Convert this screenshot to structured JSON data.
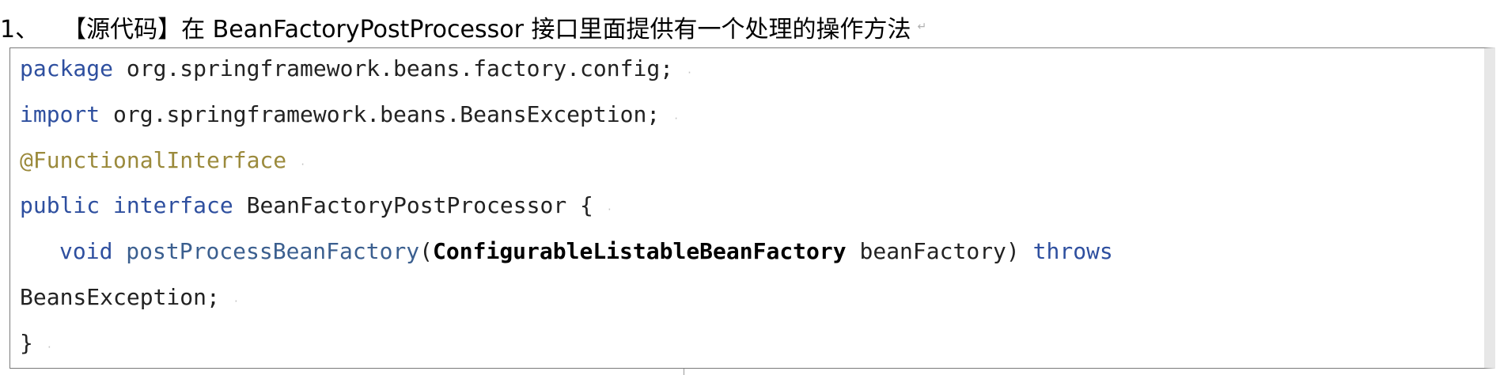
{
  "heading": {
    "number": "1、",
    "text": "【源代码】在 BeanFactoryPostProcessor 接口里面提供有一个处理的操作方法",
    "mark": "↵"
  },
  "code": {
    "line1_kw": "package",
    "line1_rest": " org.springframework.beans.factory.config;",
    "line2_kw": "import",
    "line2_rest": " org.springframework.beans.BeansException;",
    "line3_ann": "@FunctionalInterface",
    "line4_kw1": "public",
    "line4_kw2": "interface",
    "line4_rest": " BeanFactoryPostProcessor {",
    "line5_kw": "void",
    "line5_fn": "postProcessBeanFactory",
    "line5_paren": "(",
    "line5_type": "ConfigurableListableBeanFactory",
    "line5_param": " beanFactory)",
    "line5_throws": "throws",
    "line6_text": "BeansException;",
    "line7_text": "}",
    "mark": "·"
  }
}
